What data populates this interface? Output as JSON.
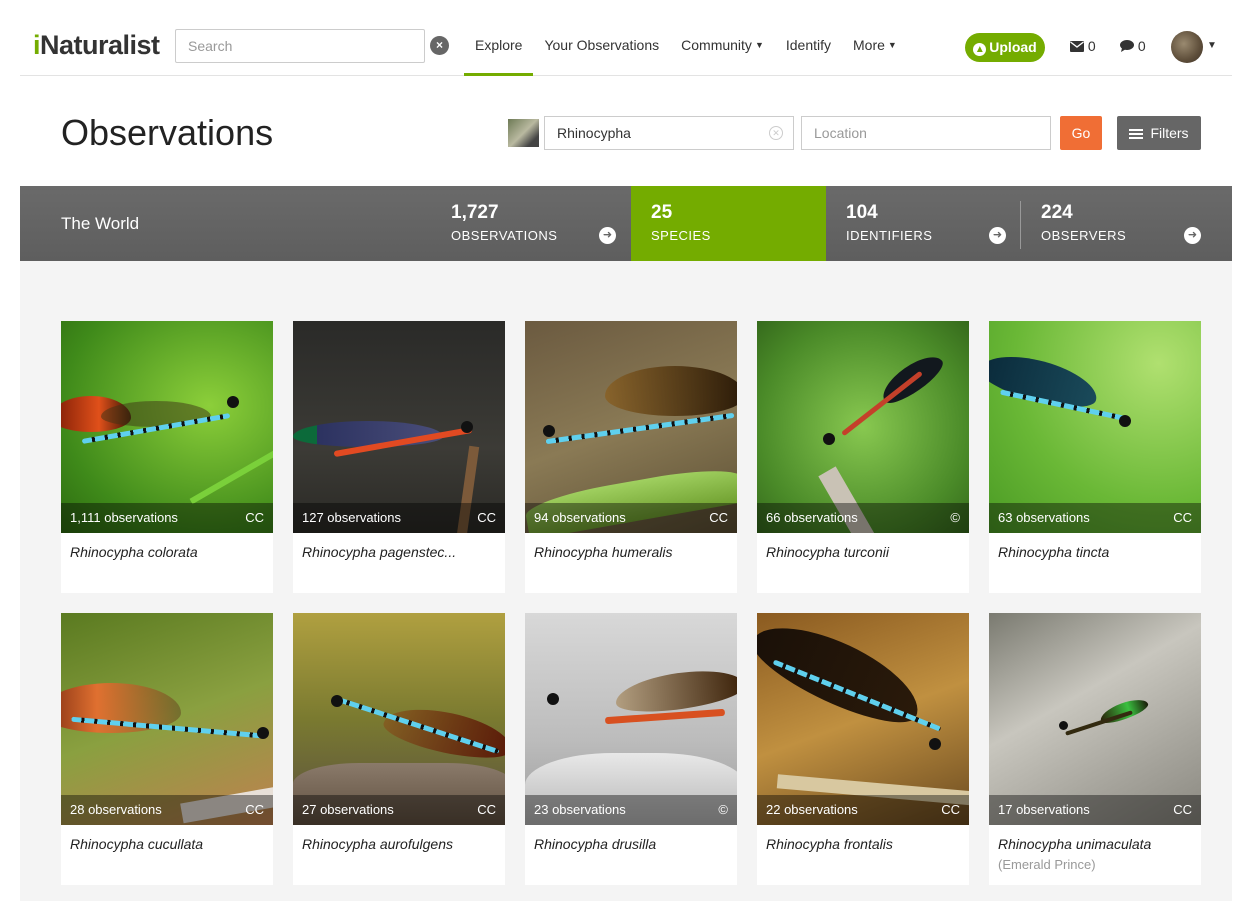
{
  "nav": {
    "logo_i": "i",
    "logo_rest": "Naturalist",
    "search_placeholder": "Search",
    "clear_glyph": "×",
    "links": [
      "Explore",
      "Your Observations",
      "Community",
      "Identify",
      "More"
    ],
    "upload_label": "Upload",
    "messages_count": "0",
    "notifications_count": "0"
  },
  "header": {
    "title": "Observations",
    "taxon_value": "Rhinocypha",
    "location_placeholder": "Location",
    "go_label": "Go",
    "filters_label": "Filters"
  },
  "stats": {
    "place": "The World",
    "items": [
      {
        "num": "1,727",
        "label": "OBSERVATIONS"
      },
      {
        "num": "25",
        "label": "SPECIES"
      },
      {
        "num": "104",
        "label": "IDENTIFIERS"
      },
      {
        "num": "224",
        "label": "OBSERVERS"
      }
    ]
  },
  "species": [
    {
      "count": "1,111 observations",
      "license": "CC",
      "name": "Rhinocypha colorata",
      "common": ""
    },
    {
      "count": "127 observations",
      "license": "CC",
      "name": "Rhinocypha pagenstec...",
      "common": ""
    },
    {
      "count": "94 observations",
      "license": "CC",
      "name": "Rhinocypha humeralis",
      "common": ""
    },
    {
      "count": "66 observations",
      "license": "©",
      "name": "Rhinocypha turconii",
      "common": ""
    },
    {
      "count": "63 observations",
      "license": "CC",
      "name": "Rhinocypha tincta",
      "common": ""
    },
    {
      "count": "28 observations",
      "license": "CC",
      "name": "Rhinocypha cucullata",
      "common": ""
    },
    {
      "count": "27 observations",
      "license": "CC",
      "name": "Rhinocypha aurofulgens",
      "common": ""
    },
    {
      "count": "23 observations",
      "license": "©",
      "name": "Rhinocypha drusilla",
      "common": ""
    },
    {
      "count": "22 observations",
      "license": "CC",
      "name": "Rhinocypha frontalis",
      "common": ""
    },
    {
      "count": "17 observations",
      "license": "CC",
      "name": "Rhinocypha unimaculata",
      "common": "(Emerald Prince)"
    }
  ]
}
